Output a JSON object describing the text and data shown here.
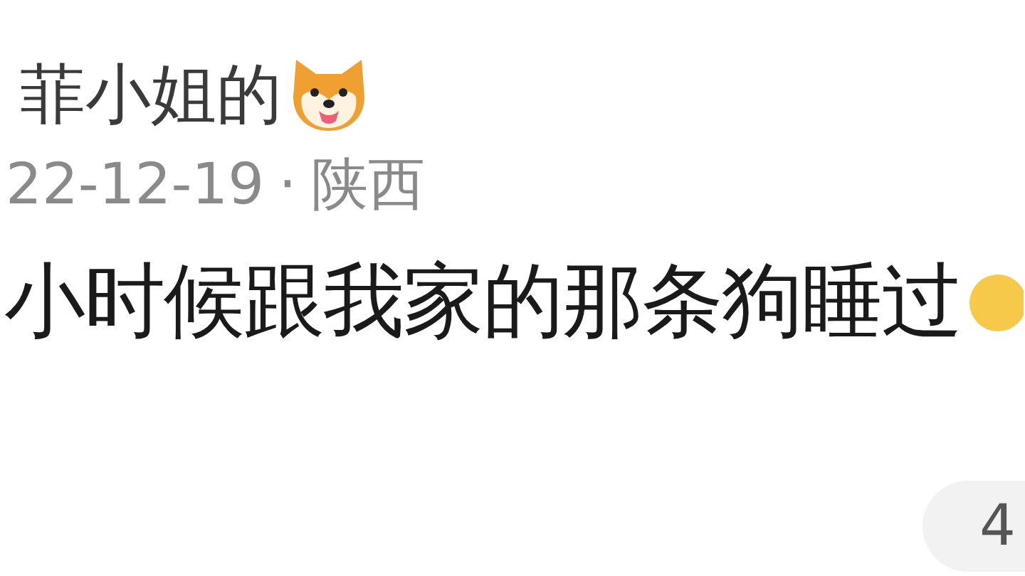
{
  "comment": {
    "author": "菲小姐的",
    "date": "22-12-19",
    "separator": "·",
    "location": "陕西",
    "text": "小时候跟我家的那条狗睡过"
  },
  "reply_button": {
    "label": "4"
  }
}
